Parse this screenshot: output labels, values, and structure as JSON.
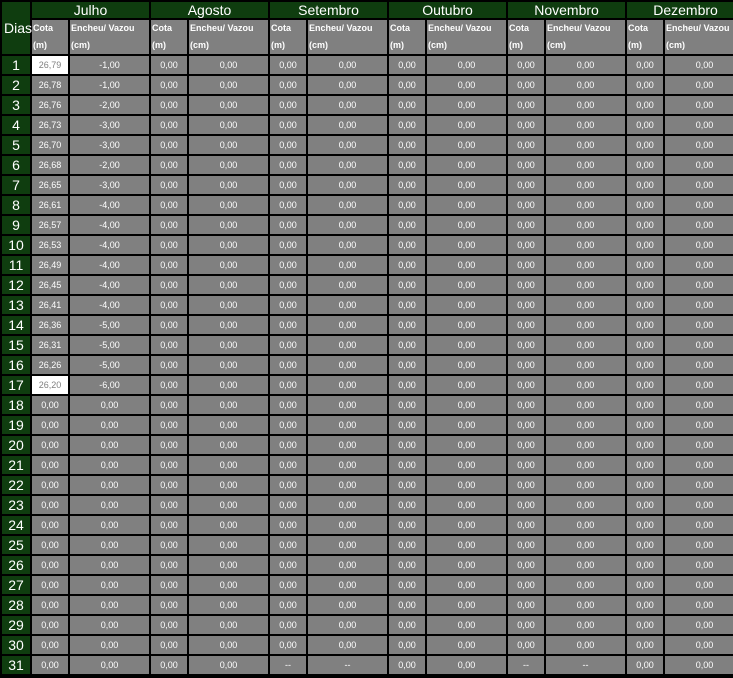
{
  "header": {
    "dias_label": "Dias",
    "cota_label_1": "Cota",
    "cota_label_2": "(m)",
    "ench_label_1": "Encheu/ Vazou",
    "ench_label_2": "(cm)"
  },
  "months": [
    "Julho",
    "Agosto",
    "Setembro",
    "Outubro",
    "Novembro",
    "Dezembro"
  ],
  "rows": [
    {
      "day": "1",
      "cells": [
        "26,79",
        "-1,00",
        "0,00",
        "0,00",
        "0,00",
        "0,00",
        "0,00",
        "0,00",
        "0,00",
        "0,00",
        "0,00",
        "0,00"
      ],
      "highlight": true
    },
    {
      "day": "2",
      "cells": [
        "26,78",
        "-1,00",
        "0,00",
        "0,00",
        "0,00",
        "0,00",
        "0,00",
        "0,00",
        "0,00",
        "0,00",
        "0,00",
        "0,00"
      ]
    },
    {
      "day": "3",
      "cells": [
        "26,76",
        "-2,00",
        "0,00",
        "0,00",
        "0,00",
        "0,00",
        "0,00",
        "0,00",
        "0,00",
        "0,00",
        "0,00",
        "0,00"
      ]
    },
    {
      "day": "4",
      "cells": [
        "26,73",
        "-3,00",
        "0,00",
        "0,00",
        "0,00",
        "0,00",
        "0,00",
        "0,00",
        "0,00",
        "0,00",
        "0,00",
        "0,00"
      ]
    },
    {
      "day": "5",
      "cells": [
        "26,70",
        "-3,00",
        "0,00",
        "0,00",
        "0,00",
        "0,00",
        "0,00",
        "0,00",
        "0,00",
        "0,00",
        "0,00",
        "0,00"
      ]
    },
    {
      "day": "6",
      "cells": [
        "26,68",
        "-2,00",
        "0,00",
        "0,00",
        "0,00",
        "0,00",
        "0,00",
        "0,00",
        "0,00",
        "0,00",
        "0,00",
        "0,00"
      ]
    },
    {
      "day": "7",
      "cells": [
        "26,65",
        "-3,00",
        "0,00",
        "0,00",
        "0,00",
        "0,00",
        "0,00",
        "0,00",
        "0,00",
        "0,00",
        "0,00",
        "0,00"
      ]
    },
    {
      "day": "8",
      "cells": [
        "26,61",
        "-4,00",
        "0,00",
        "0,00",
        "0,00",
        "0,00",
        "0,00",
        "0,00",
        "0,00",
        "0,00",
        "0,00",
        "0,00"
      ]
    },
    {
      "day": "9",
      "cells": [
        "26,57",
        "-4,00",
        "0,00",
        "0,00",
        "0,00",
        "0,00",
        "0,00",
        "0,00",
        "0,00",
        "0,00",
        "0,00",
        "0,00"
      ]
    },
    {
      "day": "10",
      "cells": [
        "26,53",
        "-4,00",
        "0,00",
        "0,00",
        "0,00",
        "0,00",
        "0,00",
        "0,00",
        "0,00",
        "0,00",
        "0,00",
        "0,00"
      ]
    },
    {
      "day": "11",
      "cells": [
        "26,49",
        "-4,00",
        "0,00",
        "0,00",
        "0,00",
        "0,00",
        "0,00",
        "0,00",
        "0,00",
        "0,00",
        "0,00",
        "0,00"
      ]
    },
    {
      "day": "12",
      "cells": [
        "26,45",
        "-4,00",
        "0,00",
        "0,00",
        "0,00",
        "0,00",
        "0,00",
        "0,00",
        "0,00",
        "0,00",
        "0,00",
        "0,00"
      ]
    },
    {
      "day": "13",
      "cells": [
        "26,41",
        "-4,00",
        "0,00",
        "0,00",
        "0,00",
        "0,00",
        "0,00",
        "0,00",
        "0,00",
        "0,00",
        "0,00",
        "0,00"
      ]
    },
    {
      "day": "14",
      "cells": [
        "26,36",
        "-5,00",
        "0,00",
        "0,00",
        "0,00",
        "0,00",
        "0,00",
        "0,00",
        "0,00",
        "0,00",
        "0,00",
        "0,00"
      ]
    },
    {
      "day": "15",
      "cells": [
        "26,31",
        "-5,00",
        "0,00",
        "0,00",
        "0,00",
        "0,00",
        "0,00",
        "0,00",
        "0,00",
        "0,00",
        "0,00",
        "0,00"
      ]
    },
    {
      "day": "16",
      "cells": [
        "26,26",
        "-5,00",
        "0,00",
        "0,00",
        "0,00",
        "0,00",
        "0,00",
        "0,00",
        "0,00",
        "0,00",
        "0,00",
        "0,00"
      ]
    },
    {
      "day": "17",
      "cells": [
        "26,20",
        "-6,00",
        "0,00",
        "0,00",
        "0,00",
        "0,00",
        "0,00",
        "0,00",
        "0,00",
        "0,00",
        "0,00",
        "0,00"
      ],
      "highlight": true
    },
    {
      "day": "18",
      "cells": [
        "0,00",
        "0,00",
        "0,00",
        "0,00",
        "0,00",
        "0,00",
        "0,00",
        "0,00",
        "0,00",
        "0,00",
        "0,00",
        "0,00"
      ]
    },
    {
      "day": "19",
      "cells": [
        "0,00",
        "0,00",
        "0,00",
        "0,00",
        "0,00",
        "0,00",
        "0,00",
        "0,00",
        "0,00",
        "0,00",
        "0,00",
        "0,00"
      ]
    },
    {
      "day": "20",
      "cells": [
        "0,00",
        "0,00",
        "0,00",
        "0,00",
        "0,00",
        "0,00",
        "0,00",
        "0,00",
        "0,00",
        "0,00",
        "0,00",
        "0,00"
      ]
    },
    {
      "day": "21",
      "cells": [
        "0,00",
        "0,00",
        "0,00",
        "0,00",
        "0,00",
        "0,00",
        "0,00",
        "0,00",
        "0,00",
        "0,00",
        "0,00",
        "0,00"
      ]
    },
    {
      "day": "22",
      "cells": [
        "0,00",
        "0,00",
        "0,00",
        "0,00",
        "0,00",
        "0,00",
        "0,00",
        "0,00",
        "0,00",
        "0,00",
        "0,00",
        "0,00"
      ]
    },
    {
      "day": "23",
      "cells": [
        "0,00",
        "0,00",
        "0,00",
        "0,00",
        "0,00",
        "0,00",
        "0,00",
        "0,00",
        "0,00",
        "0,00",
        "0,00",
        "0,00"
      ]
    },
    {
      "day": "24",
      "cells": [
        "0,00",
        "0,00",
        "0,00",
        "0,00",
        "0,00",
        "0,00",
        "0,00",
        "0,00",
        "0,00",
        "0,00",
        "0,00",
        "0,00"
      ]
    },
    {
      "day": "25",
      "cells": [
        "0,00",
        "0,00",
        "0,00",
        "0,00",
        "0,00",
        "0,00",
        "0,00",
        "0,00",
        "0,00",
        "0,00",
        "0,00",
        "0,00"
      ]
    },
    {
      "day": "26",
      "cells": [
        "0,00",
        "0,00",
        "0,00",
        "0,00",
        "0,00",
        "0,00",
        "0,00",
        "0,00",
        "0,00",
        "0,00",
        "0,00",
        "0,00"
      ]
    },
    {
      "day": "27",
      "cells": [
        "0,00",
        "0,00",
        "0,00",
        "0,00",
        "0,00",
        "0,00",
        "0,00",
        "0,00",
        "0,00",
        "0,00",
        "0,00",
        "0,00"
      ]
    },
    {
      "day": "28",
      "cells": [
        "0,00",
        "0,00",
        "0,00",
        "0,00",
        "0,00",
        "0,00",
        "0,00",
        "0,00",
        "0,00",
        "0,00",
        "0,00",
        "0,00"
      ]
    },
    {
      "day": "29",
      "cells": [
        "0,00",
        "0,00",
        "0,00",
        "0,00",
        "0,00",
        "0,00",
        "0,00",
        "0,00",
        "0,00",
        "0,00",
        "0,00",
        "0,00"
      ]
    },
    {
      "day": "30",
      "cells": [
        "0,00",
        "0,00",
        "0,00",
        "0,00",
        "0,00",
        "0,00",
        "0,00",
        "0,00",
        "0,00",
        "0,00",
        "0,00",
        "0,00"
      ]
    },
    {
      "day": "31",
      "cells": [
        "0,00",
        "0,00",
        "0,00",
        "0,00",
        "--",
        "--",
        "0,00",
        "0,00",
        "--",
        "--",
        "0,00",
        "0,00"
      ]
    }
  ]
}
